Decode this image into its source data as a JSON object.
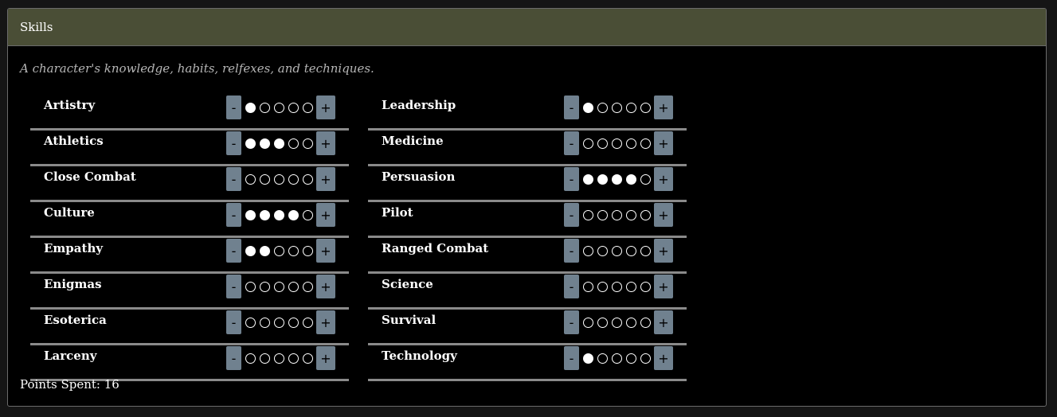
{
  "panel": {
    "title": "Skills",
    "description": "A character's knowledge, habits, relfexes, and techniques."
  },
  "controls": {
    "minus_label": "-",
    "plus_label": "+"
  },
  "max_dots": 5,
  "skills": {
    "left": [
      {
        "name": "Artistry",
        "value": 1
      },
      {
        "name": "Athletics",
        "value": 3
      },
      {
        "name": "Close Combat",
        "value": 0
      },
      {
        "name": "Culture",
        "value": 4
      },
      {
        "name": "Empathy",
        "value": 2
      },
      {
        "name": "Enigmas",
        "value": 0
      },
      {
        "name": "Esoterica",
        "value": 0
      },
      {
        "name": "Larceny",
        "value": 0
      }
    ],
    "right": [
      {
        "name": "Leadership",
        "value": 1
      },
      {
        "name": "Medicine",
        "value": 0
      },
      {
        "name": "Persuasion",
        "value": 4
      },
      {
        "name": "Pilot",
        "value": 0
      },
      {
        "name": "Ranged Combat",
        "value": 0
      },
      {
        "name": "Science",
        "value": 0
      },
      {
        "name": "Survival",
        "value": 0
      },
      {
        "name": "Technology",
        "value": 1
      }
    ]
  },
  "points": {
    "label": "Points Spent:",
    "value": "16"
  },
  "colors": {
    "header_bg": "#4a4e36",
    "button_bg": "#70818f",
    "background": "#000000",
    "divider": "#8a8a8a"
  }
}
